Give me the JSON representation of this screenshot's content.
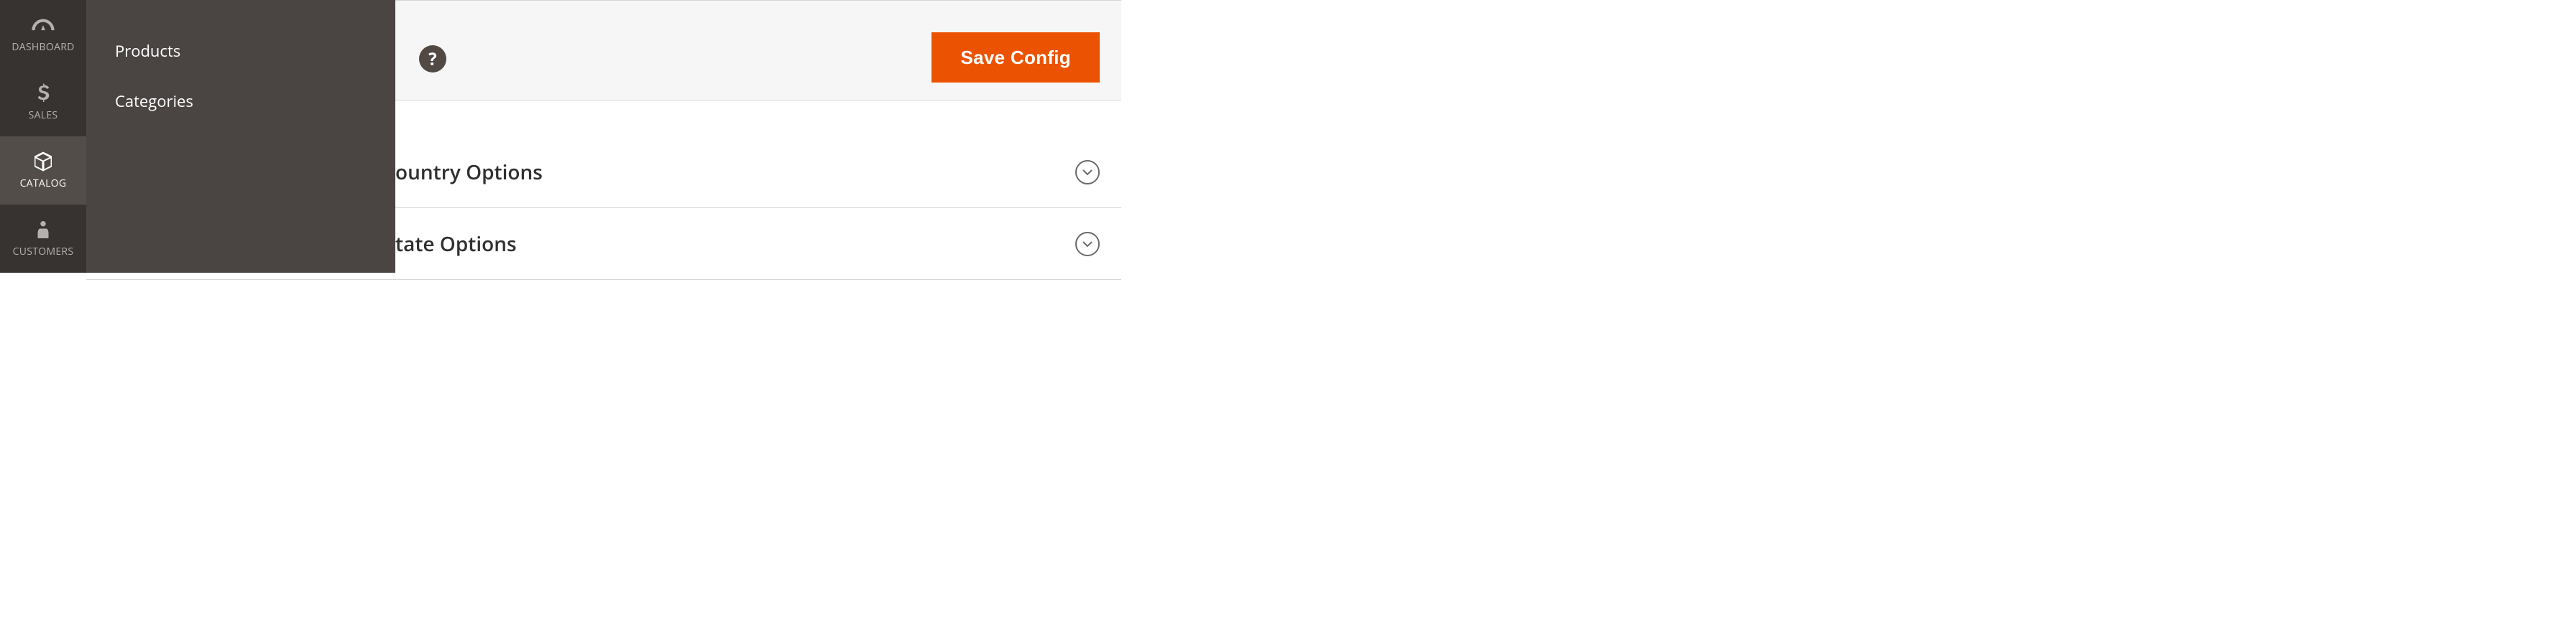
{
  "sidebar": {
    "items": [
      {
        "label": "DASHBOARD"
      },
      {
        "label": "SALES"
      },
      {
        "label": "CATALOG"
      },
      {
        "label": "CUSTOMERS"
      }
    ]
  },
  "flyout": {
    "items": [
      {
        "label": "Products"
      },
      {
        "label": "Categories"
      }
    ]
  },
  "topbar": {
    "help_glyph": "?",
    "save_label": "Save Config"
  },
  "sections": [
    {
      "title": "ountry Options"
    },
    {
      "title": "tate Options"
    }
  ]
}
